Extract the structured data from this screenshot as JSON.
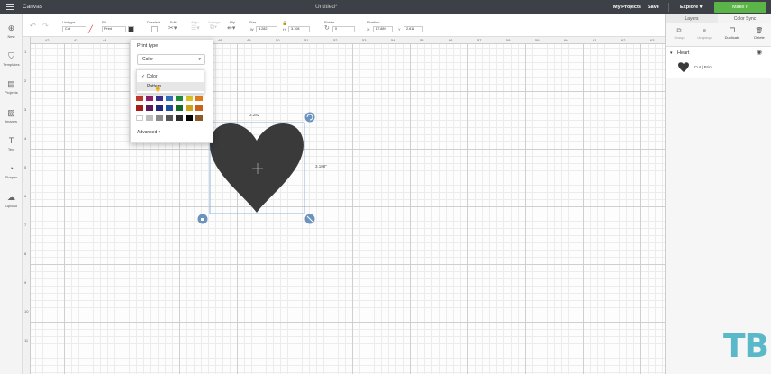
{
  "topbar": {
    "app_name": "Canvas",
    "doc_title": "Untitled*",
    "my_projects": "My Projects",
    "save": "Save",
    "machine": "Explore",
    "make": "Make It"
  },
  "toolbar": {
    "linetype_label": "Linetype",
    "linetype_value": "Cut",
    "fill_label": "Fill",
    "fill_value": "Print",
    "deselect_label": "Deselect",
    "edit_label": "Edit",
    "align_label": "Align",
    "arrange_label": "Arrange",
    "flip_label": "Flip",
    "size_label": "Size",
    "w_label": "W",
    "w_value": "3.282",
    "h_label": "H",
    "h_value": "3.108",
    "rotate_label": "Rotate",
    "rotate_value": "0",
    "position_label": "Position",
    "x_label": "X",
    "x_value": "47.889",
    "y_label": "Y",
    "y_value": "2.611"
  },
  "sidebar": [
    {
      "label": "New",
      "icon": "plus-circle-icon"
    },
    {
      "label": "Templates",
      "icon": "shirt-icon"
    },
    {
      "label": "Projects",
      "icon": "projects-icon"
    },
    {
      "label": "Images",
      "icon": "image-icon"
    },
    {
      "label": "Text",
      "icon": "text-icon"
    },
    {
      "label": "Shapes",
      "icon": "shapes-icon"
    },
    {
      "label": "Upload",
      "icon": "upload-icon"
    }
  ],
  "ruler": {
    "h": [
      "42",
      "43",
      "44",
      "45",
      "46",
      "47",
      "48",
      "49",
      "50",
      "51",
      "52",
      "53",
      "54",
      "55",
      "56",
      "57",
      "58",
      "59",
      "60",
      "61",
      "62",
      "63",
      "64"
    ],
    "v": [
      "1",
      "2",
      "3",
      "4",
      "5",
      "6",
      "7",
      "8",
      "9",
      "10",
      "11"
    ]
  },
  "dropdown": {
    "title": "Print type",
    "selected": "Color",
    "options": [
      "Color",
      "Pattern"
    ],
    "advanced": "Advanced"
  },
  "swatches": [
    [
      "#c0392b",
      "#8e1f6a",
      "#3b2f8f",
      "#2f6fc0",
      "#1e8c3a",
      "#d7c21f",
      "#e07b1b"
    ],
    [
      "#a51e1e",
      "#5b1a5a",
      "#1f2a7a",
      "#1c4f9e",
      "#136b2a",
      "#c9a51a",
      "#c9611a"
    ],
    [
      "#ffffff",
      "#bdbdbd",
      "#8a8a8a",
      "#555555",
      "#2d2d2d",
      "#000000",
      "#8b5a2b"
    ]
  ],
  "heart": {
    "width_label": "3.282\"",
    "height_label": "3.108\"",
    "color": "#3a3a3a"
  },
  "layers": {
    "tab_layers": "Layers",
    "tab_sync": "Color Sync",
    "actions": [
      "Group",
      "Ungroup",
      "Duplicate",
      "Delete"
    ],
    "layer_name": "Heart",
    "layer_type": "Cut | Print"
  },
  "watermark": "TB"
}
